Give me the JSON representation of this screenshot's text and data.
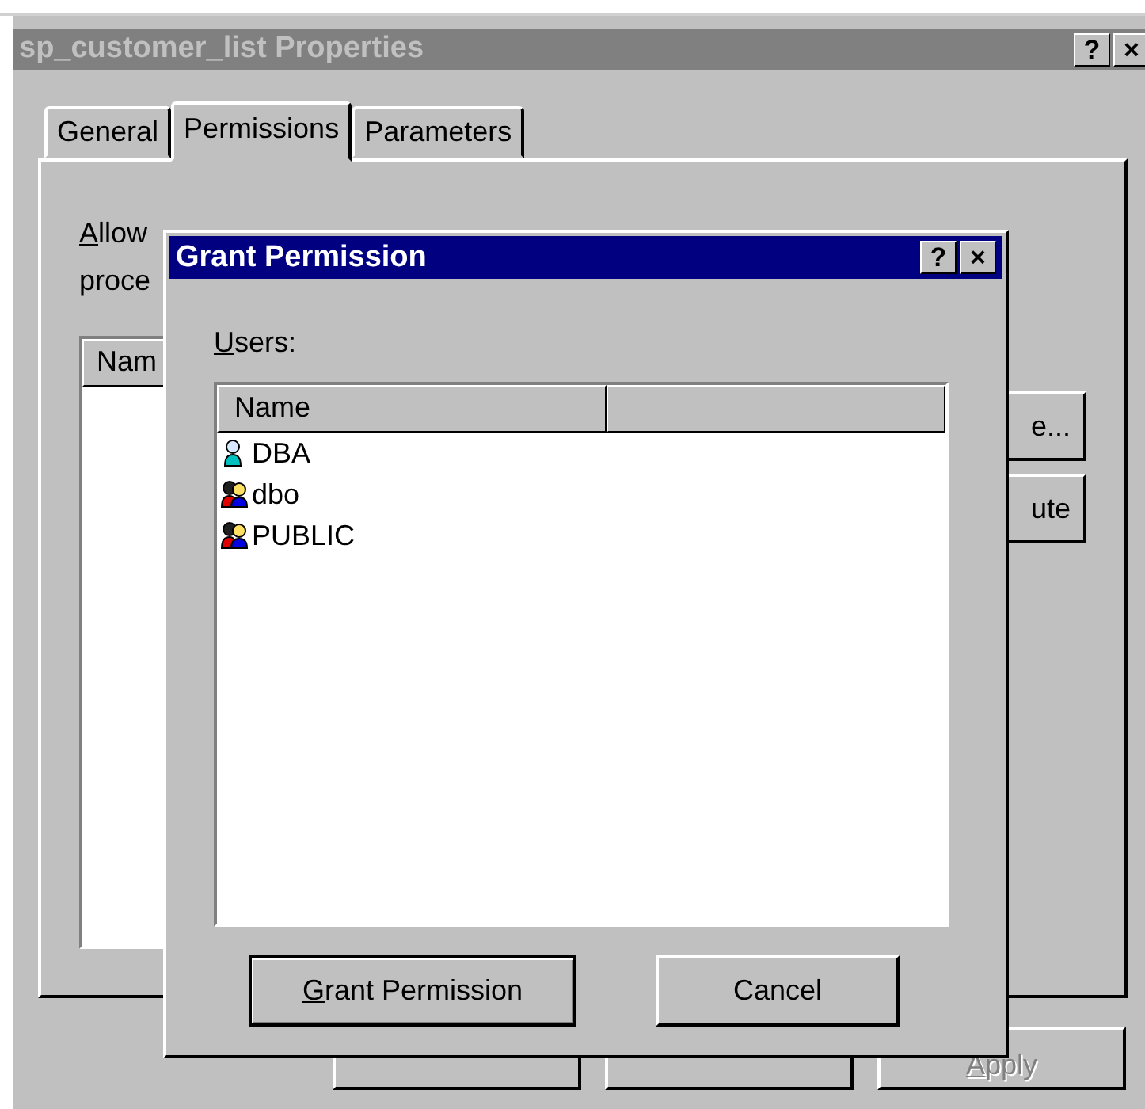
{
  "window": {
    "title": "sp_customer_list Properties",
    "help_button": "?",
    "close_button": "×"
  },
  "tabs": [
    {
      "label": "General",
      "selected": false
    },
    {
      "label": "Permissions",
      "selected": true
    },
    {
      "label": "Parameters",
      "selected": false
    }
  ],
  "panel": {
    "description_lines": [
      "Allow",
      "proce"
    ],
    "list_header": "Nam",
    "buttons": [
      "e...",
      "ute"
    ]
  },
  "footer_buttons": [
    {
      "disabled": false
    },
    {
      "disabled": false
    },
    {
      "label": "Apply",
      "disabled": true
    }
  ],
  "dialog": {
    "title": "Grant Permission",
    "help_button": "?",
    "close_button": "×",
    "users_label": "Users:",
    "columns": [
      "Name"
    ],
    "users": [
      {
        "name": "DBA",
        "kind": "user"
      },
      {
        "name": "dbo",
        "kind": "group"
      },
      {
        "name": "PUBLIC",
        "kind": "group"
      }
    ],
    "buttons": [
      {
        "label": "Grant Permission",
        "default": true
      },
      {
        "label": "Cancel",
        "default": false
      }
    ]
  }
}
